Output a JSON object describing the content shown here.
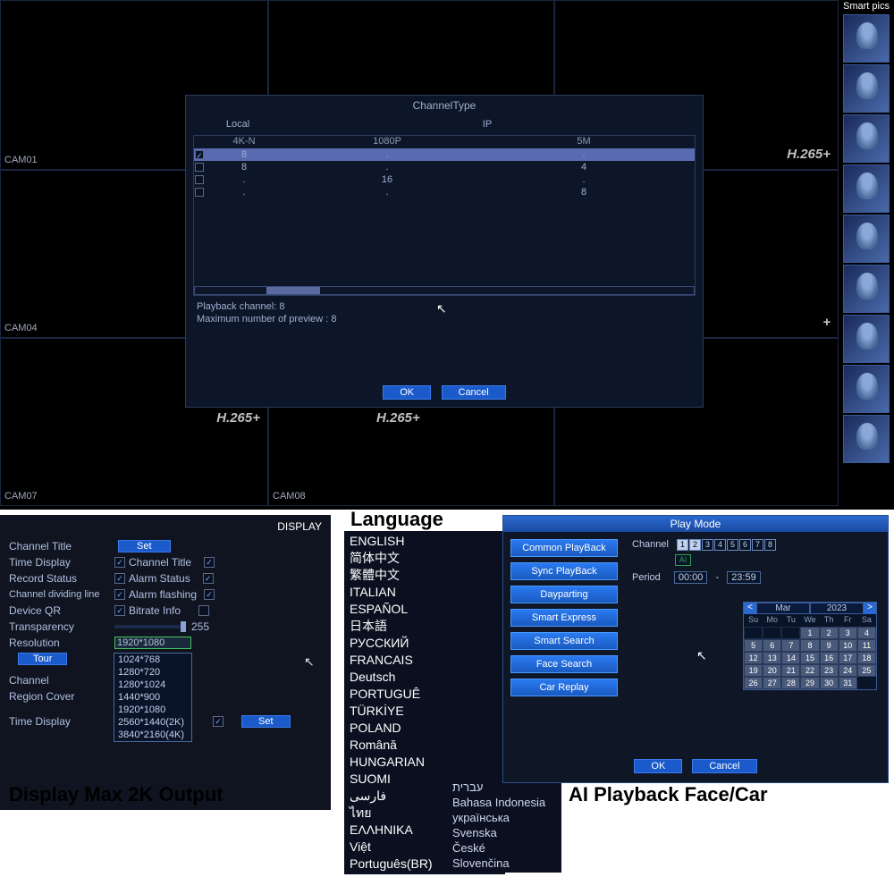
{
  "main": {
    "codec": "H.265+",
    "cams": [
      "CAM01",
      "CAM04",
      "CAM07",
      "CAM08"
    ],
    "smart_pics": "Smart pics",
    "dialog": {
      "title": "ChannelType",
      "group_local": "Local",
      "group_ip": "IP",
      "cols": [
        "4K-N",
        "1080P",
        "5M"
      ],
      "rows": [
        {
          "sel": true,
          "c1": "8",
          "c2": ".",
          "c3": "."
        },
        {
          "sel": false,
          "c1": "8",
          "c2": ".",
          "c3": "4"
        },
        {
          "sel": false,
          "c1": ".",
          "c2": "16",
          "c3": "."
        },
        {
          "sel": false,
          "c1": ".",
          "c2": ".",
          "c3": "8"
        }
      ],
      "playback_label": "Playback channel: 8",
      "maxprev_label": "Maximum number of preview   : 8",
      "ok": "OK",
      "cancel": "Cancel"
    }
  },
  "display": {
    "title": "DISPLAY",
    "rows": {
      "channel_title": "Channel Title",
      "set": "Set",
      "time_display": "Time Display",
      "channel_title2": "Channel Title",
      "record_status": "Record Status",
      "alarm_status": "Alarm Status",
      "channel_dividing": "Channel dividing line",
      "alarm_flashing": "Alarm flashing",
      "device_qr": "Device QR",
      "bitrate_info": "Bitrate Info",
      "transparency": "Transparency",
      "transparency_val": "255",
      "resolution": "Resolution",
      "resolution_val": "1920*1080",
      "tour": "Tour",
      "channel": "Channel",
      "region_cover": "Region Cover",
      "time_display2": "Time Display"
    },
    "options": [
      "1024*768",
      "1280*720",
      "1280*1024",
      "1440*900",
      "1920*1080",
      "2560*1440(2K)",
      "3840*2160(4K)"
    ],
    "caption": "Display Max 2K Output"
  },
  "language": {
    "caption": "Language",
    "items": [
      "ENGLISH",
      "简体中文",
      "繁體中文",
      "ITALIAN",
      "ESPAÑOL",
      "日本語",
      "РУССКИЙ",
      "FRANCAIS",
      "Deutsch",
      "PORTUGUÊ",
      "TÜRKİYE",
      "POLAND",
      "Română",
      "HUNGARIAN",
      "SUOMI",
      "فارسی",
      "ไทย",
      "ΕΛΛΗΝΙΚΑ",
      "Việt",
      "Português(BR)"
    ],
    "items2": [
      "עברית",
      "Bahasa Indonesia",
      "українська",
      "Svenska",
      "České",
      "Slovenčina"
    ]
  },
  "play": {
    "title": "Play Mode",
    "buttons": [
      "Common PlayBack",
      "Sync PlayBack",
      "Dayparting",
      "Smart Express",
      "Smart Search",
      "Face Search",
      "Car Replay"
    ],
    "channel_label": "Channel",
    "channels": [
      "1",
      "2",
      "3",
      "4",
      "5",
      "6",
      "7",
      "8"
    ],
    "all": "AI",
    "period_label": "Period",
    "period_from": "00:00",
    "period_sep": "-",
    "period_to": "23:59",
    "month": "Mar",
    "year": "2023",
    "dow": [
      "Su",
      "Mo",
      "Tu",
      "We",
      "Th",
      "Fr",
      "Sa"
    ],
    "days": [
      "",
      "",
      "",
      "1",
      "2",
      "3",
      "4",
      "5",
      "6",
      "7",
      "8",
      "9",
      "10",
      "11",
      "12",
      "13",
      "14",
      "15",
      "16",
      "17",
      "18",
      "19",
      "20",
      "21",
      "22",
      "23",
      "24",
      "25",
      "26",
      "27",
      "28",
      "29",
      "30",
      "31"
    ],
    "ok": "OK",
    "cancel": "Cancel",
    "caption": "AI Playback Face/Car"
  }
}
